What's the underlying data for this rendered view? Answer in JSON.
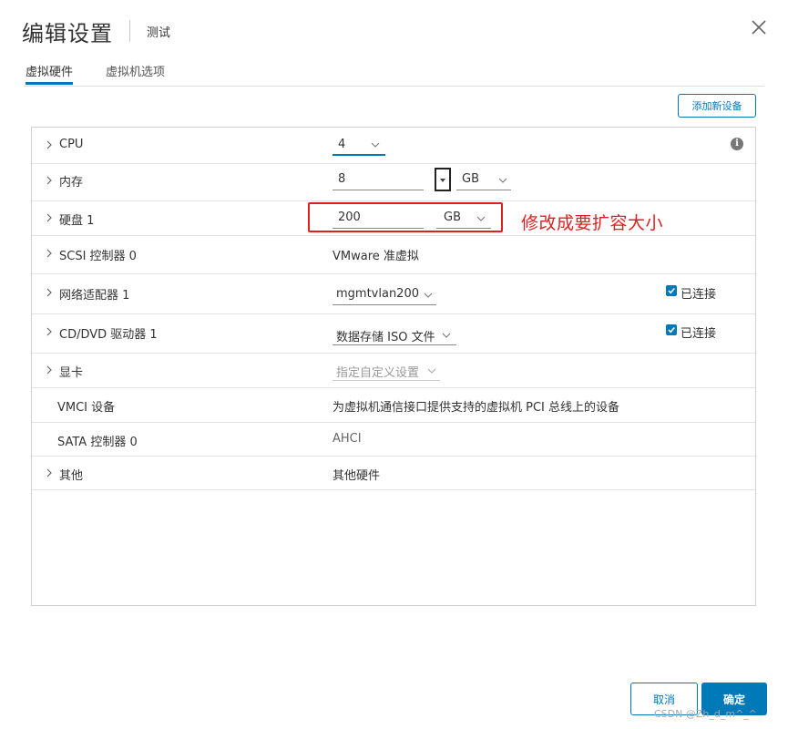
{
  "dialog": {
    "title": "编辑设置",
    "subtitle": "测试"
  },
  "tabs": [
    {
      "label": "虚拟硬件",
      "active": true
    },
    {
      "label": "虚拟机选项",
      "active": false
    }
  ],
  "toolbar": {
    "add_device_label": "添加新设备"
  },
  "rows": {
    "cpu": {
      "label": "CPU",
      "value": "4"
    },
    "memory": {
      "label": "内存",
      "value": "8",
      "unit": "GB"
    },
    "disk": {
      "label": "硬盘 1",
      "value": "200",
      "unit": "GB"
    },
    "scsi": {
      "label": "SCSI 控制器 0",
      "value": "VMware 准虚拟"
    },
    "network": {
      "label": "网络适配器 1",
      "value": "mgmtvlan200",
      "connected_label": "已连接",
      "connected": true
    },
    "cddvd": {
      "label": "CD/DVD 驱动器 1",
      "value": "数据存储 ISO 文件",
      "connected_label": "已连接",
      "connected": true
    },
    "gpu": {
      "label": "显卡",
      "value": "指定自定义设置"
    },
    "vmci": {
      "label": "VMCI 设备",
      "value": "为虚拟机通信接口提供支持的虚拟机 PCI 总线上的设备"
    },
    "sata": {
      "label": "SATA 控制器 0",
      "value": "AHCI"
    },
    "other": {
      "label": "其他",
      "value": "其他硬件"
    }
  },
  "annotation": {
    "text": "修改成要扩容大小",
    "color": "#e02020"
  },
  "footer": {
    "cancel_label": "取消",
    "ok_label": "确定"
  },
  "watermark": "CSDN @Zh_d_m^_^",
  "icons": {
    "close": "close-icon",
    "info": "info-icon",
    "chevron": "chevron-right-icon",
    "caret": "chevron-down-icon",
    "check": "check-icon"
  },
  "colors": {
    "accent": "#0079b8",
    "annotation": "#e02020"
  }
}
